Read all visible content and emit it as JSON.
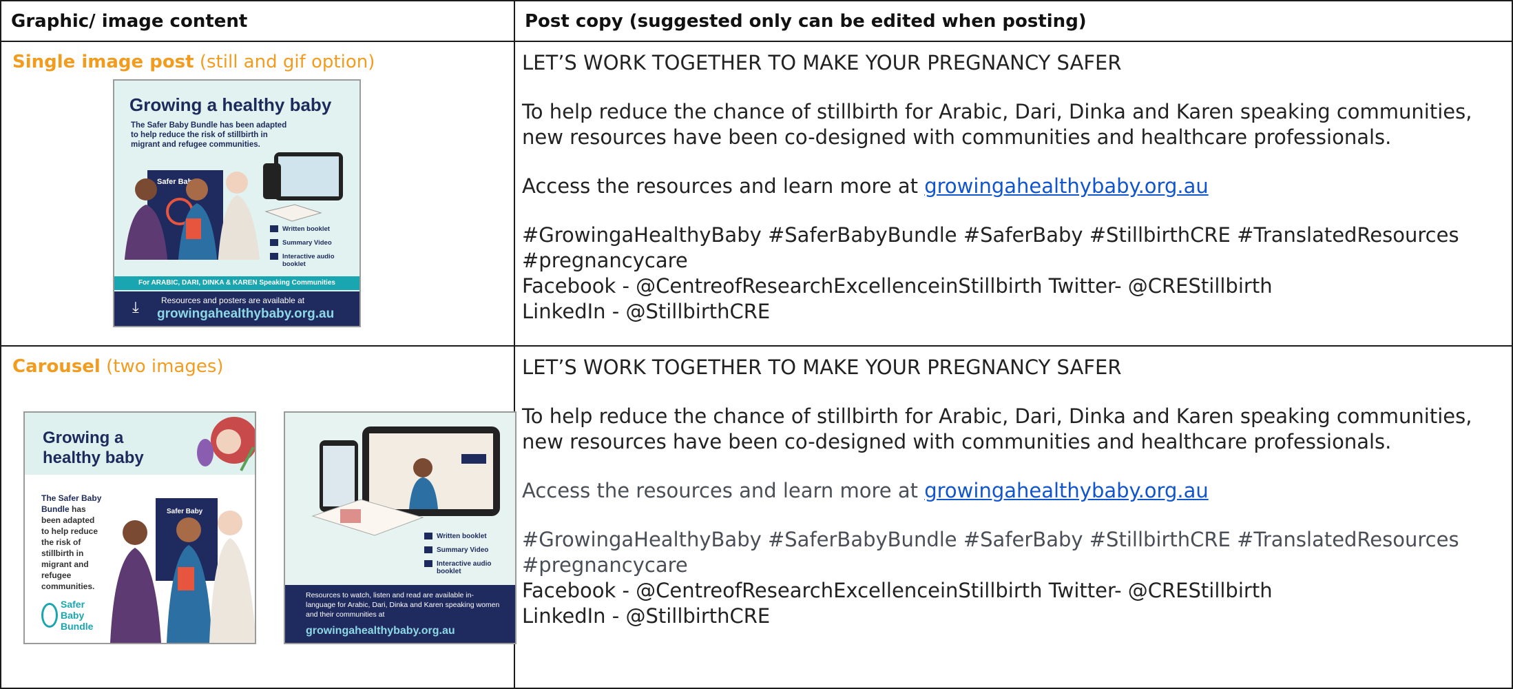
{
  "header": {
    "col1": "Graphic/ image content",
    "col2": "Post copy (suggested only can be edited when posting)"
  },
  "rows": [
    {
      "type_bold": "Single image post",
      "type_rest": " (still and gif option)",
      "headline": "LET’S WORK TOGETHER TO MAKE YOUR PREGNANCY SAFER",
      "intro": "To help reduce the chance of stillbirth for Arabic, Dari, Dinka and Karen speaking communities, new resources have been co-designed with communities and healthcare professionals.",
      "access_text": "Access the resources and learn more at ",
      "link": "growingahealthybaby.org.au",
      "hashtags": "#GrowingaHealthyBaby #SaferBabyBundle #SaferBaby #StillbirthCRE #TranslatedResources #pregnancycare",
      "facebook": "Facebook - @CentreofResearchExcellenceinStillbirth  Twitter- @CREStillbirth",
      "linkedin": "LinkedIn -  @StillbirthCRE"
    },
    {
      "type_bold": "Carousel",
      "type_rest": " (two images)",
      "headline": "LET’S WORK TOGETHER TO MAKE YOUR PREGNANCY SAFER",
      "intro": "To help reduce the chance of stillbirth for Arabic, Dari, Dinka and Karen speaking communities, new resources have been co-designed with communities and healthcare professionals.",
      "access_text": "Access the resources and learn more at ",
      "link": "growingahealthybaby.org.au",
      "hashtags": "#GrowingaHealthyBaby #SaferBabyBundle #SaferBaby #StillbirthCRE #TranslatedResources #pregnancycare",
      "facebook": "Facebook - @CentreofResearchExcellenceinStillbirth  Twitter-  @CREStillbirth",
      "linkedin": "LinkedIn -  @StillbirthCRE"
    }
  ],
  "graphic1": {
    "title": "Growing a healthy baby",
    "body": "The Safer Baby Bundle has been adapted to help reduce the risk of stillbirth in migrant and refugee communities.",
    "banner": "Safer Baby",
    "items": [
      "Written booklet",
      "Summary Video",
      "Interactive audio booklet"
    ],
    "teal": "For ARABIC, DARI, DINKA & KAREN Speaking Communities",
    "cta": "Resources and posters are available at",
    "url": "growingahealthybaby.org.au"
  },
  "graphic2": {
    "title": "Growing a healthy baby",
    "body_bold": "The Safer Baby Bundle",
    "body_rest": " has been adapted to help reduce the risk of stillbirth in migrant and refugee communities.",
    "banner": "Safer Baby",
    "logo": [
      "Safer",
      "Baby",
      "Bundle"
    ]
  },
  "graphic3": {
    "items": [
      "Written booklet",
      "Summary Video",
      "Interactive audio booklet"
    ],
    "footer": "Resources to watch, listen and read are available in-language for Arabic, Dari, Dinka and Karen speaking women and their communities at",
    "url": "growingahealthybaby.org.au"
  },
  "colors": {
    "accent": "#f29c1f",
    "link": "#1155cc",
    "navy": "#1f2a5e",
    "teal": "#19a6b0"
  }
}
